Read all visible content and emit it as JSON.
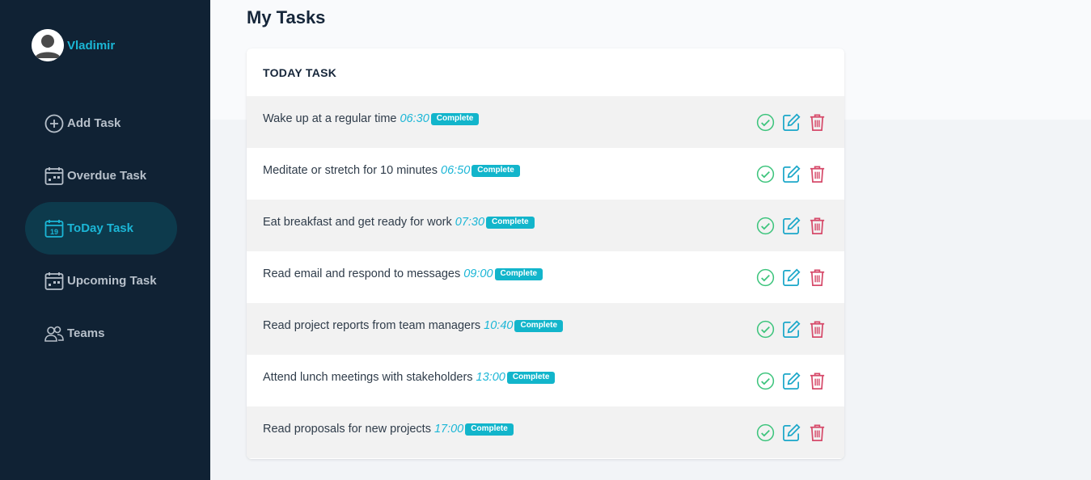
{
  "user": {
    "name": "Vladimir"
  },
  "nav": [
    {
      "label": "Add Task",
      "icon": "plus-circle-icon",
      "active": false
    },
    {
      "label": "Overdue Task",
      "icon": "calendar-icon",
      "active": false
    },
    {
      "label": "ToDay Task",
      "icon": "calendar-today-icon",
      "active": true,
      "day": "19"
    },
    {
      "label": "Upcoming Task",
      "icon": "calendar-icon",
      "active": false
    },
    {
      "label": "Teams",
      "icon": "people-icon",
      "active": false
    }
  ],
  "page": {
    "title": "My Tasks"
  },
  "card": {
    "header": "TODAY TASK",
    "tasks": [
      {
        "text": "Wake up at a regular time",
        "time": "06:30",
        "status": "Complete"
      },
      {
        "text": "Meditate or stretch for 10 minutes",
        "time": "06:50",
        "status": "Complete"
      },
      {
        "text": "Eat breakfast and get ready for work",
        "time": "07:30",
        "status": "Complete"
      },
      {
        "text": "Read email and respond to messages",
        "time": "09:00",
        "status": "Complete"
      },
      {
        "text": "Read project reports from team managers",
        "time": "10:40",
        "status": "Complete"
      },
      {
        "text": "Attend lunch meetings with stakeholders",
        "time": "13:00",
        "status": "Complete"
      },
      {
        "text": "Read proposals for new projects",
        "time": "17:00",
        "status": "Complete"
      }
    ]
  },
  "colors": {
    "sidebar": "#102234",
    "accent": "#1bb6d6",
    "badge": "#12b5cb",
    "check": "#3cc47c",
    "edit": "#1ba7c9",
    "delete": "#d64a6a"
  }
}
